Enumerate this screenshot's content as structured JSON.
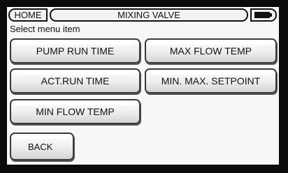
{
  "header": {
    "home_label": "HOME",
    "title": "MIXING VALVE",
    "battery_icon": "battery-icon"
  },
  "subtitle": "Select menu item",
  "menu": {
    "pump_run_time": "PUMP RUN TIME",
    "max_flow_temp": "MAX FLOW TEMP",
    "act_run_time": "ACT.RUN TIME",
    "min_max_setpoint": "MIN. MAX. SETPOINT",
    "min_flow_temp": "MIN FLOW TEMP",
    "back": "BACK"
  }
}
